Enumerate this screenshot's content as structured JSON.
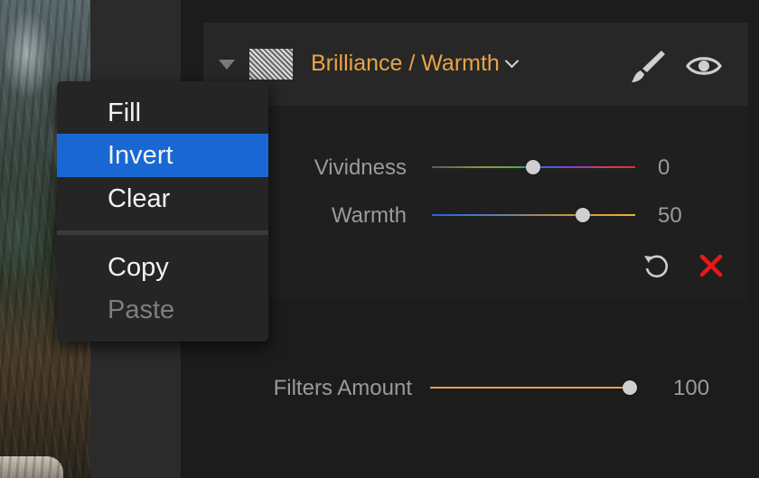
{
  "layer": {
    "filter_name": "Brilliance / Warmth",
    "icons": [
      "collapse-arrow-icon",
      "brush-icon",
      "eye-icon"
    ],
    "accent_color": "#e8a445"
  },
  "sliders": [
    {
      "label": "Vividness",
      "value": "0",
      "position": 0.5
    },
    {
      "label": "Warmth",
      "value": "50",
      "position": 0.75
    }
  ],
  "actions": {
    "icons": [
      "reset-icon",
      "delete-icon"
    ],
    "delete_color": "#e81818"
  },
  "filters_amount": {
    "label": "Filters Amount",
    "value": "100",
    "position": 1.0
  },
  "context_menu": {
    "items": [
      {
        "label": "Fill",
        "state": "normal"
      },
      {
        "label": "Invert",
        "state": "selected"
      },
      {
        "label": "Clear",
        "state": "normal"
      },
      {
        "label": "Copy",
        "state": "normal"
      },
      {
        "label": "Paste",
        "state": "disabled"
      }
    ],
    "highlight_color": "#1967d2"
  }
}
